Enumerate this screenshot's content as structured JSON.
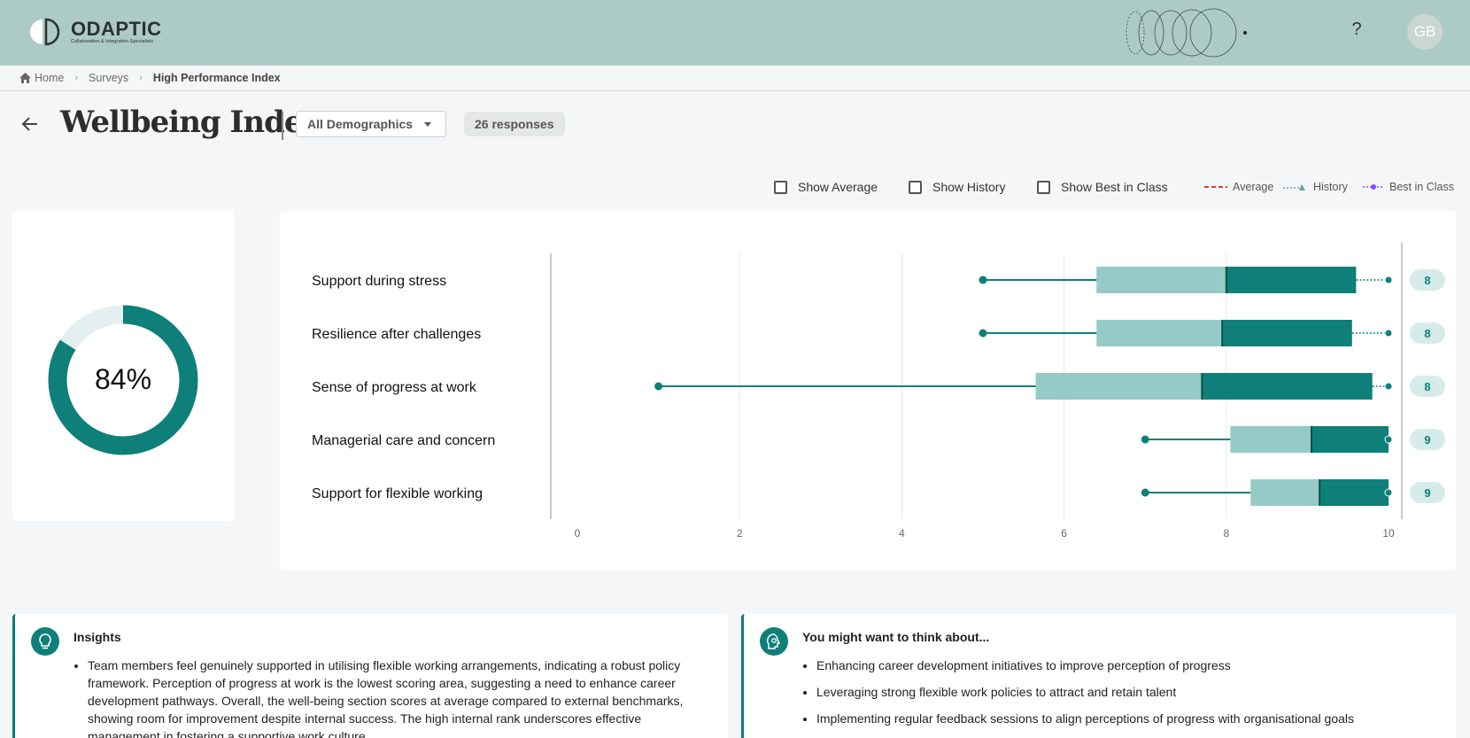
{
  "header": {
    "logo_name": "ODAPTIC",
    "logo_tagline": "Collaboration & Integration Specialists",
    "help_label": "?",
    "avatar_initials": "GB"
  },
  "breadcrumb": {
    "home": "Home",
    "surveys": "Surveys",
    "current": "High Performance Index"
  },
  "page": {
    "title": "Wellbeing Index",
    "demographics_value": "All Demographics",
    "responses_label": "26 responses"
  },
  "toggles": {
    "show_average": "Show Average",
    "show_history": "Show History",
    "show_best": "Show Best in Class"
  },
  "legend": {
    "average": "Average",
    "history": "History",
    "best": "Best in Class",
    "average_color": "#e53935",
    "history_color": "#6aa39b",
    "best_color": "#7c4dff"
  },
  "gauge": {
    "value_label": "84%",
    "fraction": 0.84
  },
  "colors": {
    "teal": "#0e7f79",
    "teal_light": "#96cac7",
    "badge_bg": "#d6ecea"
  },
  "chart_data": {
    "type": "box",
    "x_ticks": [
      "0",
      "2",
      "4",
      "6",
      "8",
      "10"
    ],
    "xlim": [
      0,
      10
    ],
    "rows": [
      {
        "label": "Support during stress",
        "min": 5,
        "q1": 6.4,
        "median": 8,
        "q3": 9.6,
        "max": 10,
        "score": "8"
      },
      {
        "label": "Resilience after challenges",
        "min": 5,
        "q1": 6.4,
        "median": 7.95,
        "q3": 9.55,
        "max": 10,
        "score": "8"
      },
      {
        "label": "Sense of progress at work",
        "min": 1,
        "q1": 5.65,
        "median": 7.7,
        "q3": 9.8,
        "max": 10,
        "score": "8"
      },
      {
        "label": "Managerial care and concern",
        "min": 7,
        "q1": 8.05,
        "median": 9.05,
        "q3": 10,
        "max": 10,
        "score": "9"
      },
      {
        "label": "Support for flexible working",
        "min": 7,
        "q1": 8.3,
        "median": 9.15,
        "q3": 10,
        "max": 10,
        "score": "9"
      }
    ]
  },
  "insights": {
    "title": "Insights",
    "items": [
      "Team members feel genuinely supported in utilising flexible working arrangements, indicating a robust policy framework. Perception of progress at work is the lowest scoring area, suggesting a need to enhance career development pathways. Overall, the well-being section scores at average compared to external benchmarks, showing room for improvement despite internal success. The high internal rank underscores effective management in fostering a supportive work culture."
    ]
  },
  "think_about": {
    "title": "You might want to think about...",
    "items": [
      "Enhancing career development initiatives to improve perception of progress",
      "Leveraging strong flexible work policies to attract and retain talent",
      "Implementing regular feedback sessions to align perceptions of progress with organisational goals"
    ]
  }
}
